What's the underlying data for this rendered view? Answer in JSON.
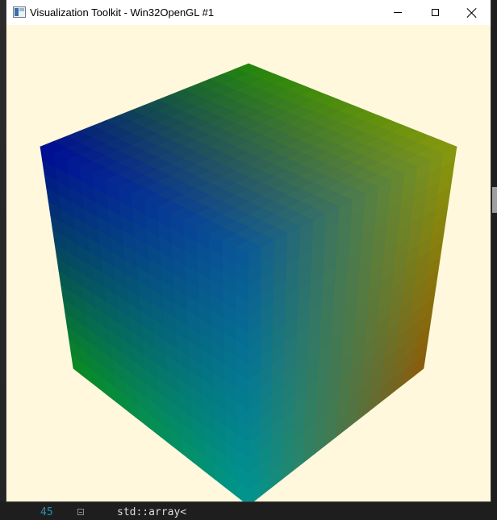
{
  "window": {
    "title": "Visualization Toolkit - Win32OpenGL #1",
    "icon": "vtk-window-icon",
    "controls": {
      "minimize": "minimize-icon",
      "maximize": "maximize-icon",
      "close": "close-icon"
    }
  },
  "render": {
    "background_color": "#fff8dc",
    "cube_vertex_colors": {
      "top": "#22880a",
      "upper_left": "#000a96",
      "upper_right": "#8a9a0a",
      "center": "#0a5a96",
      "lower_left": "#0a8c1e",
      "lower_right": "#8c5a0a",
      "bottom": "#009690"
    }
  },
  "background_editor": {
    "line_number": "45",
    "code_text": "std::array<"
  }
}
